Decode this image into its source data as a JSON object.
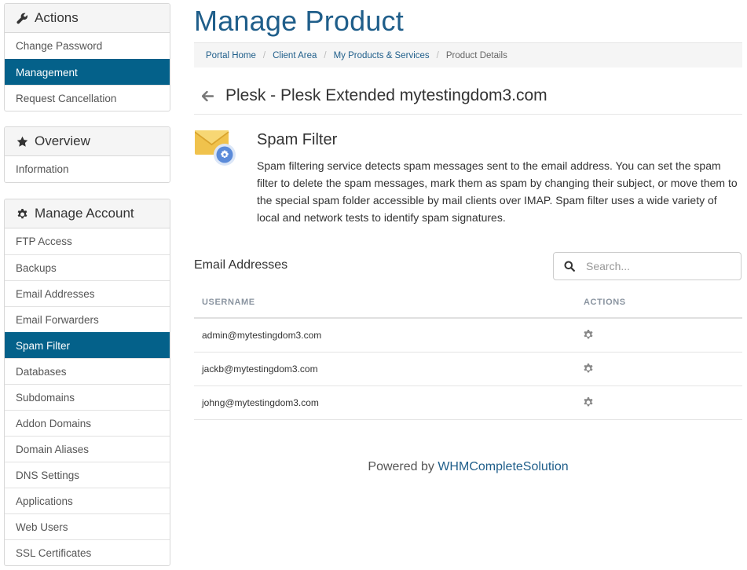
{
  "sidebar": {
    "actions": {
      "title": "Actions",
      "icon": "wrench-icon",
      "items": [
        "Change Password",
        "Management",
        "Request Cancellation"
      ],
      "active": "Management"
    },
    "overview": {
      "title": "Overview",
      "icon": "star-icon",
      "items": [
        "Information"
      ]
    },
    "manage": {
      "title": "Manage Account",
      "icon": "gear-icon",
      "items": [
        "FTP Access",
        "Backups",
        "Email Addresses",
        "Email Forwarders",
        "Spam Filter",
        "Databases",
        "Subdomains",
        "Addon Domains",
        "Domain Aliases",
        "DNS Settings",
        "Applications",
        "Web Users",
        "SSL Certificates"
      ],
      "active": "Spam Filter"
    }
  },
  "page": {
    "title": "Manage Product",
    "breadcrumb": [
      "Portal Home",
      "Client Area",
      "My Products & Services"
    ],
    "breadcrumb_current": "Product Details",
    "product_name": "Plesk - Plesk Extended mytestingdom3.com"
  },
  "spam_filter": {
    "title": "Spam Filter",
    "description": "Spam filtering service detects spam messages sent to the email address. You can set the spam filter to delete the spam messages, mark them as spam by changing their subject, or move them to the special spam folder accessible by mail clients over IMAP. Spam filter uses a wide variety of local and network tests to identify spam signatures."
  },
  "email_addresses": {
    "title": "Email Addresses",
    "search_placeholder": "Search...",
    "columns": [
      "USERNAME",
      "ACTIONS"
    ],
    "rows": [
      "admin@mytestingdom3.com",
      "jackb@mytestingdom3.com",
      "johng@mytestingdom3.com"
    ]
  },
  "footer": {
    "prefix": "Powered by ",
    "link": "WHMCompleteSolution"
  },
  "colors": {
    "accent": "#04618a",
    "title": "#1f5e8a",
    "envelope": "#f0c24c",
    "gear_badge": "#5b8bd9"
  }
}
